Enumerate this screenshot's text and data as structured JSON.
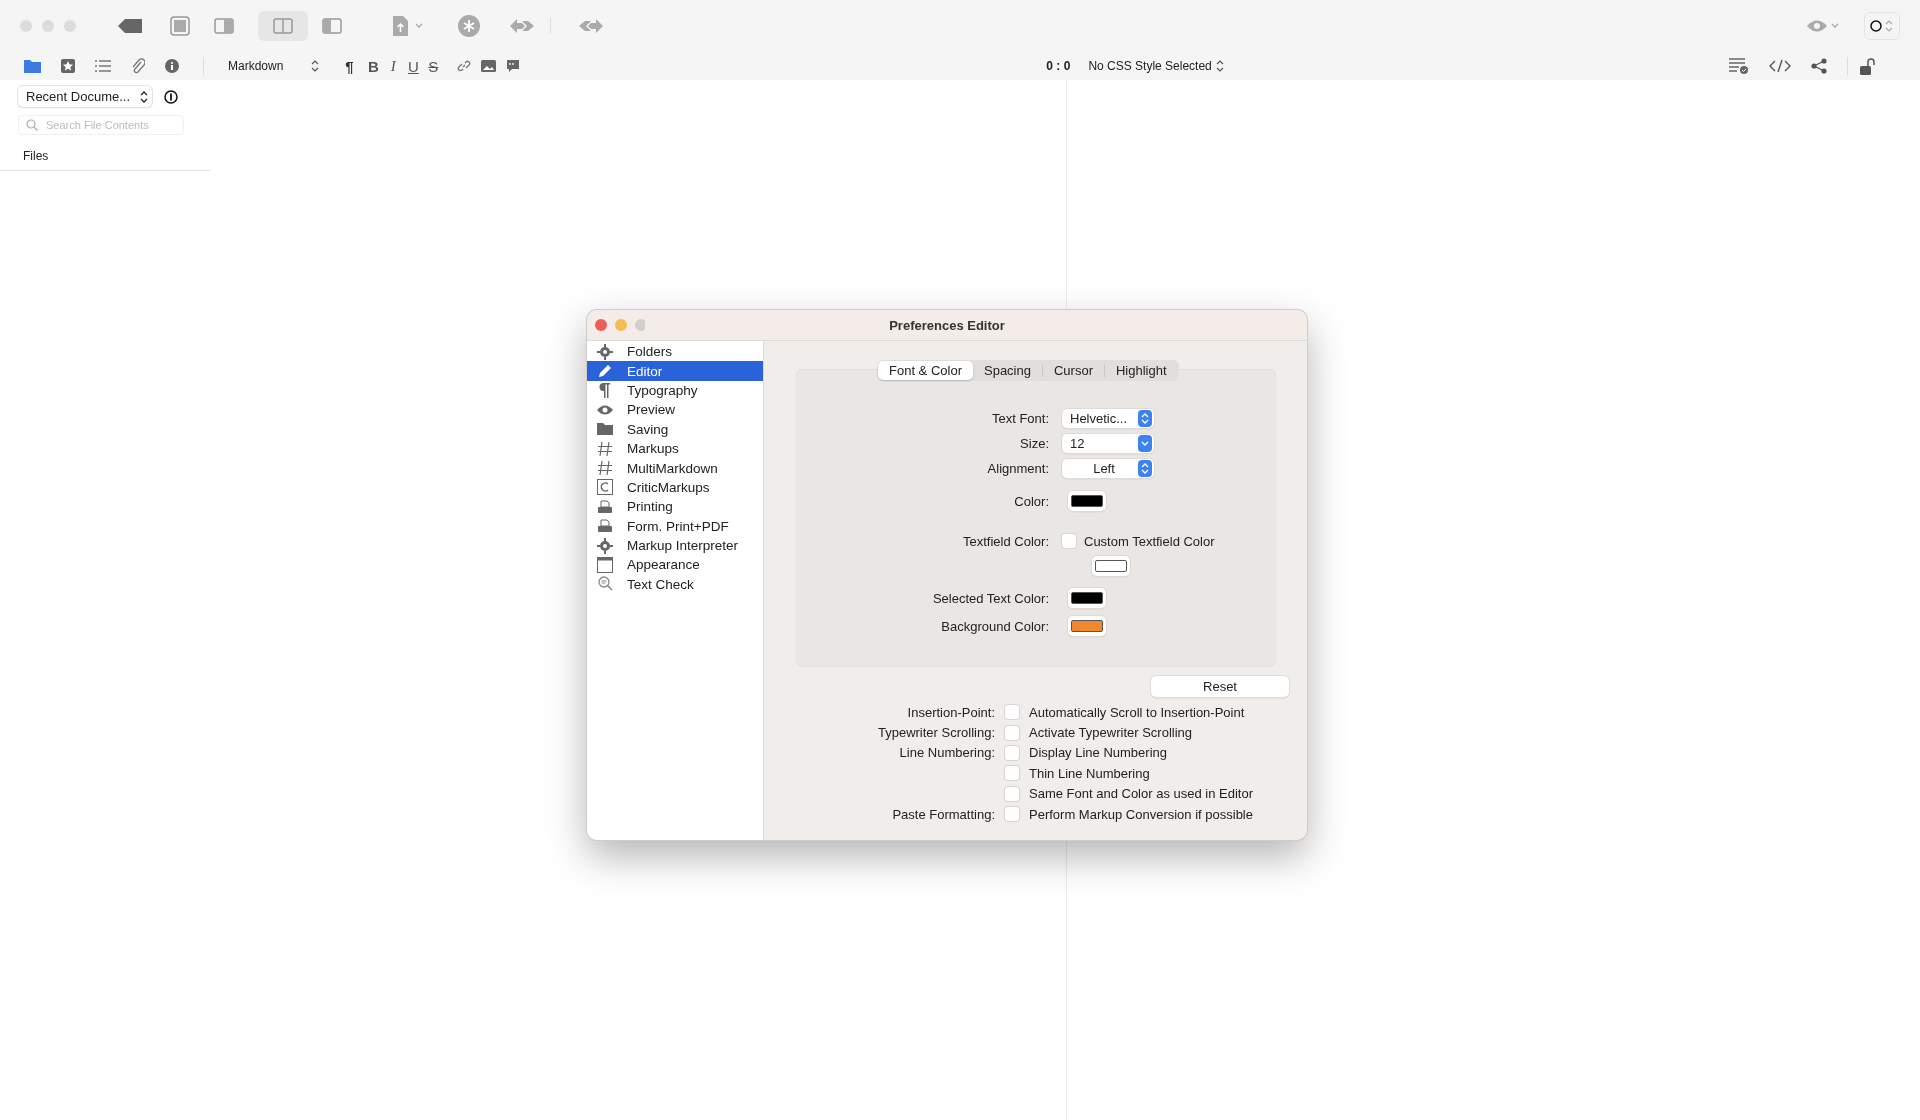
{
  "format_bar": {
    "syntax": "Markdown",
    "buttons": [
      {
        "kind": "paragraph",
        "label": "¶"
      },
      {
        "kind": "bold",
        "label": "B"
      },
      {
        "kind": "italic",
        "label": "I"
      },
      {
        "kind": "underline",
        "label": "U"
      },
      {
        "kind": "strike",
        "label": "S"
      }
    ],
    "cursor_position": "0 : 0",
    "css_style": "No CSS Style Selected"
  },
  "sidebar": {
    "recent_popup": "Recent Docume...",
    "search": {
      "placeholder": "Search File Contents"
    },
    "section": "Files"
  },
  "dialog": {
    "title": "Preferences Editor",
    "categories": [
      {
        "label": "Folders",
        "selected": false
      },
      {
        "label": "Editor",
        "selected": true
      },
      {
        "label": "Typography",
        "selected": false
      },
      {
        "label": "Preview",
        "selected": false
      },
      {
        "label": "Saving",
        "selected": false
      },
      {
        "label": "Markups",
        "selected": false
      },
      {
        "label": "MultiMarkdown",
        "selected": false
      },
      {
        "label": "CriticMarkups",
        "selected": false
      },
      {
        "label": "Printing",
        "selected": false
      },
      {
        "label": "Form. Print+PDF",
        "selected": false
      },
      {
        "label": "Markup Interpreter",
        "selected": false
      },
      {
        "label": "Appearance",
        "selected": false
      },
      {
        "label": "Text Check",
        "selected": false
      }
    ],
    "tabs": [
      {
        "label": "Font & Color",
        "selected": true
      },
      {
        "label": "Spacing",
        "selected": false
      },
      {
        "label": "Cursor",
        "selected": false
      },
      {
        "label": "Highlight",
        "selected": false
      }
    ],
    "font_color": [
      {
        "kind": "popup",
        "label": "Text Font:",
        "value": "Helvetic..."
      },
      {
        "kind": "combo",
        "label": "Size:",
        "value": "12"
      },
      {
        "kind": "popup",
        "label": "Alignment:",
        "value": "Left"
      },
      {
        "kind": "swatch",
        "label": "Color:",
        "color": "#000000"
      },
      {
        "kind": "checkbox",
        "label": "Textfield Color:",
        "text": "Custom Textfield Color",
        "checked": false
      },
      {
        "kind": "swatch",
        "color": "#ffffff"
      },
      {
        "kind": "swatch",
        "label": "Selected Text Color:",
        "color": "#000000"
      },
      {
        "kind": "swatch",
        "label": "Background Color:",
        "color": "#f0882e"
      }
    ],
    "reset_button": "Reset",
    "options": [
      {
        "label": "Insertion-Point:",
        "text": "Automatically Scroll to Insertion-Point",
        "checked": false
      },
      {
        "label": "Typewriter Scrolling:",
        "text": "Activate Typewriter Scrolling",
        "checked": false
      },
      {
        "label": "Line Numbering:",
        "text": "Display Line Numbering",
        "checked": false
      },
      {
        "text": "Thin Line Numbering",
        "checked": false
      },
      {
        "text": "Same Font and Color as used in Editor",
        "checked": false
      },
      {
        "label": "Paste Formatting:",
        "text": "Perform Markup Conversion if possible",
        "checked": false
      }
    ]
  }
}
